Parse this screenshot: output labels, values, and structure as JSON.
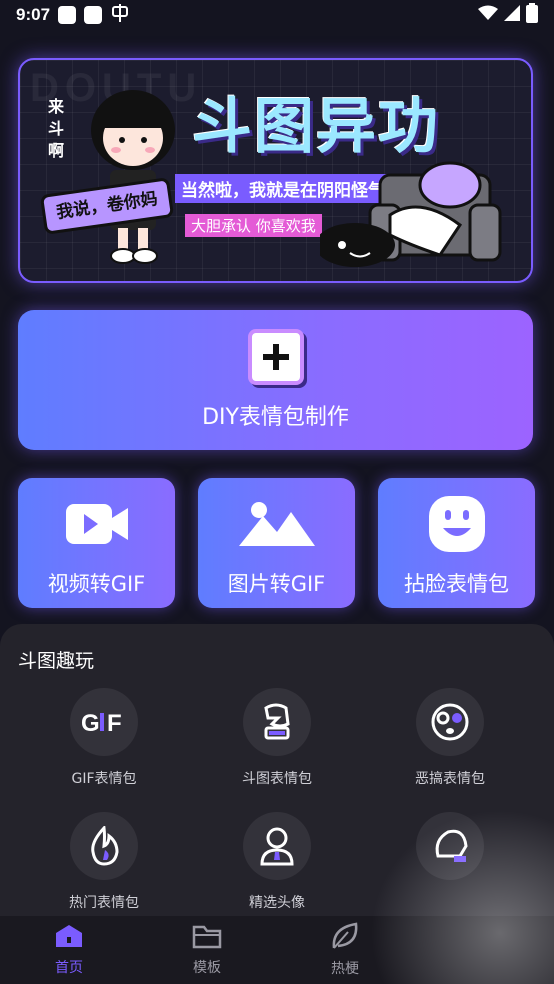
{
  "status_bar": {
    "time": "9:07"
  },
  "banner": {
    "title": "斗图异功",
    "side_text": "来斗啊",
    "ribbon_text": "我说，卷你妈",
    "line1": "当然啦，我就是在阴阳怪气",
    "line2": "大胆承认 你喜欢我"
  },
  "diy": {
    "label": "DIY表情包制作"
  },
  "tiles": [
    {
      "label": "视频转GIF",
      "icon": "video-camera-icon"
    },
    {
      "label": "图片转GIF",
      "icon": "image-icon"
    },
    {
      "label": "拈脸表情包",
      "icon": "smiley-icon"
    }
  ],
  "section": {
    "title": "斗图趣玩",
    "items": [
      {
        "label": "GIF表情包",
        "icon": "gif-icon"
      },
      {
        "label": "斗图表情包",
        "icon": "fist-icon"
      },
      {
        "label": "恶搞表情包",
        "icon": "funny-face-icon"
      },
      {
        "label": "热门表情包",
        "icon": "flame-icon"
      },
      {
        "label": "精选头像",
        "icon": "person-icon"
      },
      {
        "label": "",
        "icon": "head-icon"
      }
    ]
  },
  "nav": {
    "items": [
      {
        "label": "首页",
        "active": true
      },
      {
        "label": "模板",
        "active": false
      },
      {
        "label": "热梗",
        "active": false
      }
    ]
  },
  "colors": {
    "accent": "#7b5cff",
    "background": "#141420",
    "sheet": "#24232b"
  }
}
